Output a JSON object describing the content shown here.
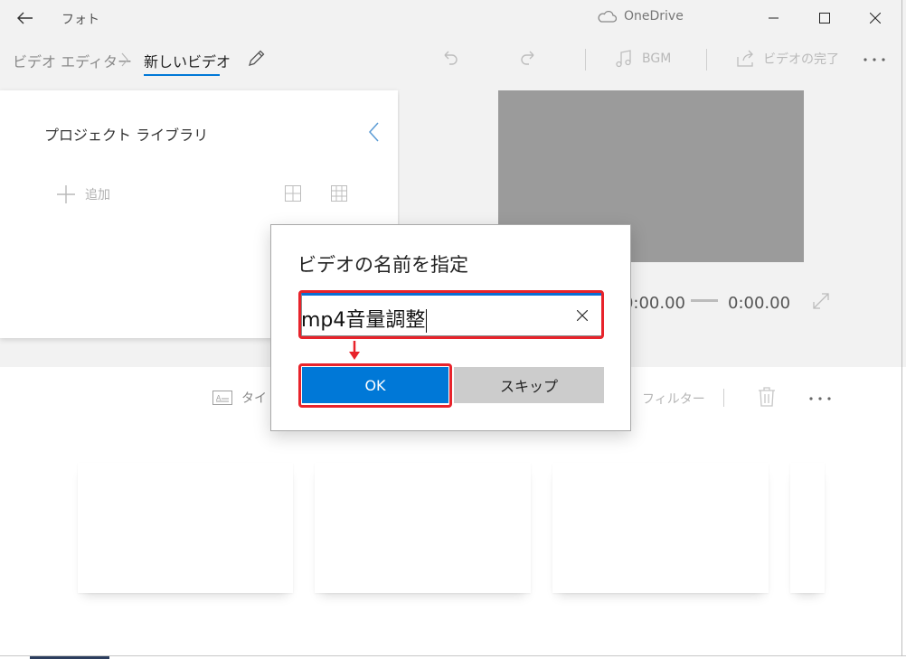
{
  "titlebar": {
    "app_name": "フォト",
    "cloud_label": "OneDrive"
  },
  "commandbar": {
    "breadcrumb_root": "ビデオ エディター",
    "breadcrumb_current": "新しいビデオ",
    "bgm_label": "BGM",
    "finish_label": "ビデオの完了"
  },
  "library": {
    "title": "プロジェクト ライブラリ",
    "add_label": "追加"
  },
  "player": {
    "current_time": "0:00.00",
    "total_time": "0:00.00"
  },
  "storyboard": {
    "title_label": "タイト",
    "filter_label": "フィルター"
  },
  "dialog": {
    "title": "ビデオの名前を指定",
    "input_value": "mp4音量調整",
    "ok_label": "OK",
    "skip_label": "スキップ"
  },
  "colors": {
    "accent": "#0078d7",
    "annotation": "#e8232b",
    "preview_bg": "#9b9b9b"
  }
}
